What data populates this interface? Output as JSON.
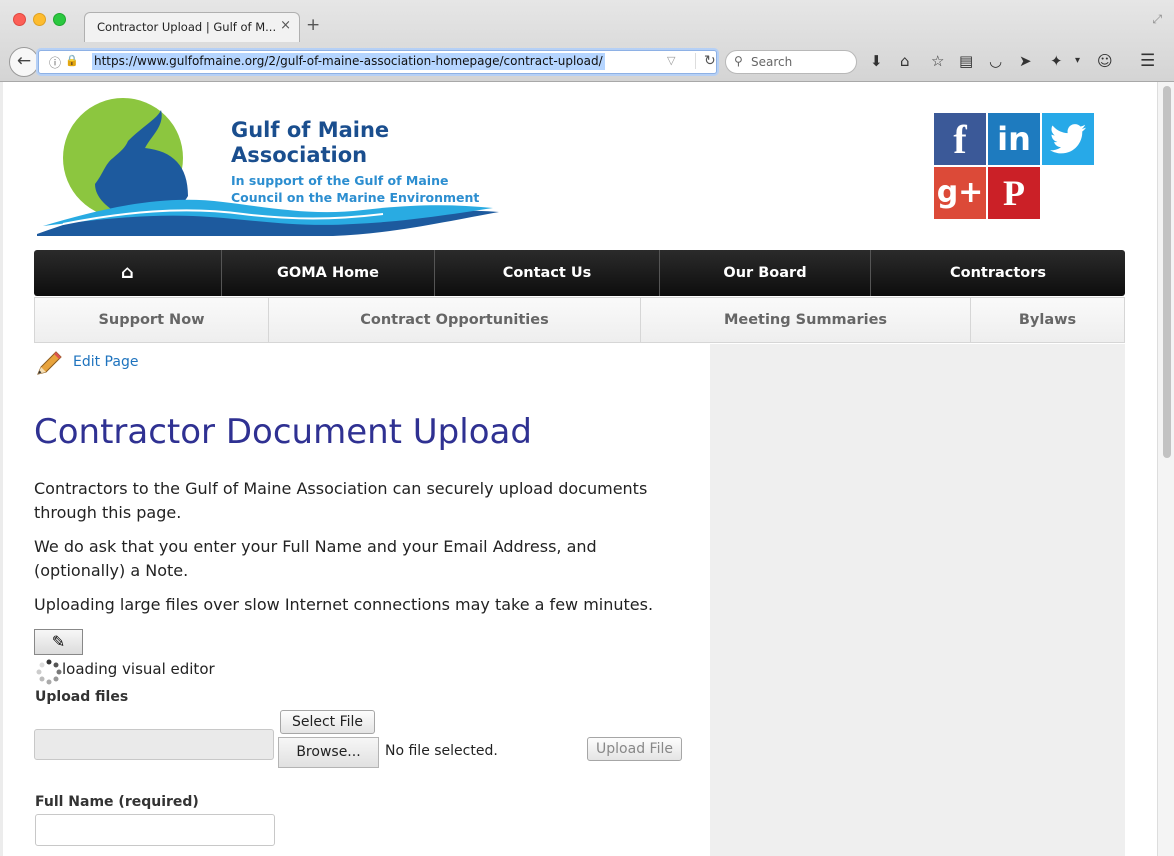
{
  "browser": {
    "tab_title": "Contractor Upload | Gulf of M...",
    "tab_close": "×",
    "new_tab": "+",
    "url": "https://www.gulfofmaine.org/2/gulf-of-maine-association-homepage/contract-upload/",
    "search_placeholder": "Search"
  },
  "logo": {
    "title_line1": "Gulf of Maine",
    "title_line2": "Association",
    "subtitle_line1": "In support of the Gulf of Maine",
    "subtitle_line2": "Council on the Marine Environment"
  },
  "social": {
    "facebook": "f",
    "linkedin": "in",
    "googleplus": "g+",
    "pinterest": "P"
  },
  "main_nav": [
    "GOMA Home",
    "Contact Us",
    "Our Board",
    "Contractors"
  ],
  "sub_nav": [
    "Support Now",
    "Contract Opportunities",
    "Meeting Summaries",
    "Bylaws"
  ],
  "edit_link": "Edit Page",
  "page": {
    "title": "Contractor Document Upload",
    "para1": "Contractors to the Gulf of Maine Association can securely upload documents through this page.",
    "para2": "We do ask that you enter your Full Name and your Email Address, and (optionally) a Note.",
    "para3": "Uploading large files over slow Internet connections may take a few minutes."
  },
  "editor": {
    "loading_text": "loading visual editor"
  },
  "form": {
    "upload_label": "Upload files",
    "select_file": "Select File",
    "browse": "Browse...",
    "no_file": "No file selected.",
    "upload_file": "Upload File",
    "full_name_label": "Full Name (required)"
  },
  "colors": {
    "title": "#2f3192",
    "link": "#1e73be",
    "nav_bg": "#111111"
  }
}
